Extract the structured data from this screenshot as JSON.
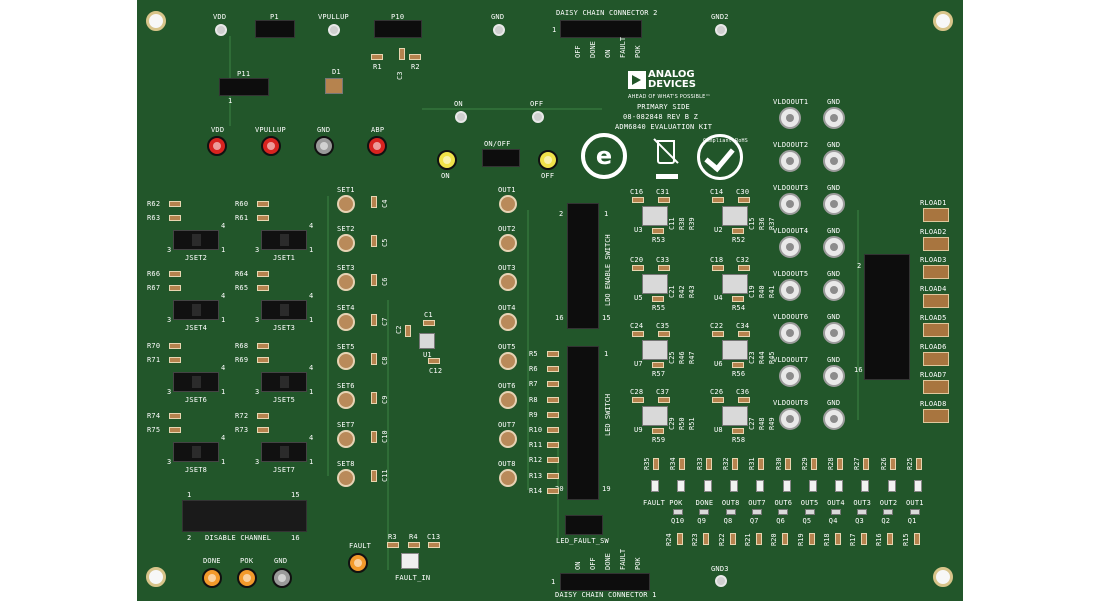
{
  "board": {
    "color": "#22562a",
    "logo": {
      "line1": "ANALOG",
      "line2": "DEVICES",
      "tagline": "AHEAD OF WHAT'S POSSIBLE™"
    },
    "info": {
      "side": "PRIMARY SIDE",
      "part": "08-082848 REV B Z",
      "kit": "ADM6840 EVALUATION KIT"
    },
    "rohs_text": "Compliant RoHS"
  },
  "top_labels": {
    "vdd": "VDD",
    "p1": "P1",
    "vpullup": "VPULLUP",
    "p10": "P10",
    "gnd": "GND",
    "gnd2": "GND2",
    "daisy2": "DAISY CHAIN CONNECTOR 2",
    "daisy2_pin1": "1",
    "r1": "R1",
    "r2": "R2",
    "c3": "C3",
    "p11": "P11",
    "p11_pin1": "1",
    "d1": "D1"
  },
  "daisy2_signals": [
    "OFF",
    "DONE",
    "ON",
    "FAULT",
    "POK"
  ],
  "power_tps": [
    {
      "label": "VDD",
      "color": "#d8231f"
    },
    {
      "label": "VPULLUP",
      "color": "#d8231f"
    },
    {
      "label": "GND",
      "color": "#9a9a9a"
    },
    {
      "label": "ABP",
      "color": "#d8231f"
    }
  ],
  "onoff": {
    "on_pad": "ON",
    "off_pad": "OFF",
    "switch": "ON/OFF",
    "on_tp": "ON",
    "off_tp": "OFF",
    "tp_color": "#f1e34a"
  },
  "jset_blocks": [
    {
      "label": "JSET2",
      "r_top": "R62",
      "r_bot": "R63"
    },
    {
      "label": "JSET1",
      "r_top": "R60",
      "r_bot": "R61"
    },
    {
      "label": "JSET4",
      "r_top": "R66",
      "r_bot": "R67"
    },
    {
      "label": "JSET3",
      "r_top": "R64",
      "r_bot": "R65"
    },
    {
      "label": "JSET6",
      "r_top": "R70",
      "r_bot": "R71"
    },
    {
      "label": "JSET5",
      "r_top": "R68",
      "r_bot": "R69"
    },
    {
      "label": "JSET8",
      "r_top": "R74",
      "r_bot": "R75"
    },
    {
      "label": "JSET7",
      "r_top": "R72",
      "r_bot": "R73"
    }
  ],
  "jset_pins": {
    "p1": "1",
    "p3": "3",
    "p4": "4"
  },
  "set_labels": [
    "SET1",
    "SET2",
    "SET3",
    "SET4",
    "SET5",
    "SET6",
    "SET7",
    "SET8"
  ],
  "set_caps": [
    "C4",
    "C5",
    "C6",
    "C7",
    "C8",
    "C9",
    "C10",
    "C11"
  ],
  "u1": {
    "label": "U1",
    "c1": "C1",
    "c2": "C2",
    "c12": "C12"
  },
  "out_labels": [
    "OUT1",
    "OUT2",
    "OUT3",
    "OUT4",
    "OUT5",
    "OUT6",
    "OUT7",
    "OUT8"
  ],
  "ldo_switch": {
    "label": "LDO ENABLE SWITCH",
    "pin_top": "1",
    "pin_top_left": "2",
    "pin_bot_left": "16",
    "pin_bot": "15"
  },
  "led_switch": {
    "label": "LED SWITCH",
    "pin_top": "1",
    "pin_top_left": "2",
    "pin_bot_left": "20",
    "pin_bot": "19",
    "resistors": [
      "R5",
      "R6",
      "R7",
      "R8",
      "R9",
      "R10",
      "R11",
      "R12",
      "R13",
      "R14"
    ]
  },
  "led_fault_sw": "LED_FAULT_SW",
  "regulators": [
    {
      "u": "U3",
      "ca": "C16",
      "cb": "C31",
      "r": "R53",
      "v1": "C11",
      "v2": "R38",
      "v3": "R39"
    },
    {
      "u": "U2",
      "ca": "C14",
      "cb": "C30",
      "r": "R52",
      "v1": "C15",
      "v2": "R36",
      "v3": "R37"
    },
    {
      "u": "U5",
      "ca": "C20",
      "cb": "C33",
      "r": "R55",
      "v1": "C21",
      "v2": "R42",
      "v3": "R43"
    },
    {
      "u": "U4",
      "ca": "C18",
      "cb": "C32",
      "r": "R54",
      "v1": "C19",
      "v2": "R40",
      "v3": "R41"
    },
    {
      "u": "U7",
      "ca": "C24",
      "cb": "C35",
      "r": "R57",
      "v1": "C25",
      "v2": "R46",
      "v3": "R47"
    },
    {
      "u": "U6",
      "ca": "C22",
      "cb": "C34",
      "r": "R56",
      "v1": "C23",
      "v2": "R44",
      "v3": "R45"
    },
    {
      "u": "U9",
      "ca": "C28",
      "cb": "C37",
      "r": "R59",
      "v1": "C29",
      "v2": "R50",
      "v3": "R51"
    },
    {
      "u": "U8",
      "ca": "C26",
      "cb": "C36",
      "r": "R58",
      "v1": "C27",
      "v2": "R48",
      "v3": "R49"
    }
  ],
  "vldo_labels": [
    "VLDOOUT1",
    "VLDOOUT2",
    "VLDOOUT3",
    "VLDOOUT4",
    "VLDOOUT5",
    "VLDOOUT6",
    "VLDOOUT7",
    "VLDOOUT8"
  ],
  "vldo_gnd": "GND",
  "rload_labels": [
    "RLOAD1",
    "RLOAD2",
    "RLOAD3",
    "RLOAD4",
    "RLOAD5",
    "RLOAD6",
    "RLOAD7",
    "RLOAD8"
  ],
  "rload_header": {
    "pin_top": "2",
    "pin_bot": "16"
  },
  "led_row": {
    "top_res": [
      "R35",
      "R34",
      "R33",
      "R32",
      "R31",
      "R30",
      "R29",
      "R28",
      "R27",
      "R26",
      "R25"
    ],
    "leds": [
      "FAULT",
      "POK",
      "DONE",
      "OUT8",
      "OUT7",
      "OUT6",
      "OUT5",
      "OUT4",
      "OUT3",
      "OUT2",
      "OUT1"
    ],
    "q": [
      "Q10",
      "Q9",
      "Q8",
      "Q7",
      "Q6",
      "Q5",
      "Q4",
      "Q3",
      "Q2",
      "Q1"
    ],
    "bot_res": [
      "R24",
      "R23",
      "R22",
      "R21",
      "R20",
      "R19",
      "R18",
      "R17",
      "R16",
      "R15"
    ]
  },
  "disable_channel": {
    "label": "DISABLE CHANNEL",
    "p1": "1",
    "p2": "2",
    "p15": "15",
    "p16": "16"
  },
  "bottom_tps": [
    {
      "label": "DONE",
      "color": "#f39a2b"
    },
    {
      "label": "POK",
      "color": "#f39a2b"
    },
    {
      "label": "GND",
      "color": "#9a9a9a"
    }
  ],
  "fault": {
    "tp_label": "FAULT",
    "tp_color": "#f39a2b",
    "r3": "R3",
    "r4": "R4",
    "c13": "C13",
    "button": "FAULT_IN"
  },
  "daisy1": {
    "label": "DAISY CHAIN CONNECTOR 1",
    "pin1": "1",
    "signals": [
      "ON",
      "OFF",
      "DONE",
      "FAULT",
      "POK"
    ]
  },
  "gnd3": "GND3"
}
